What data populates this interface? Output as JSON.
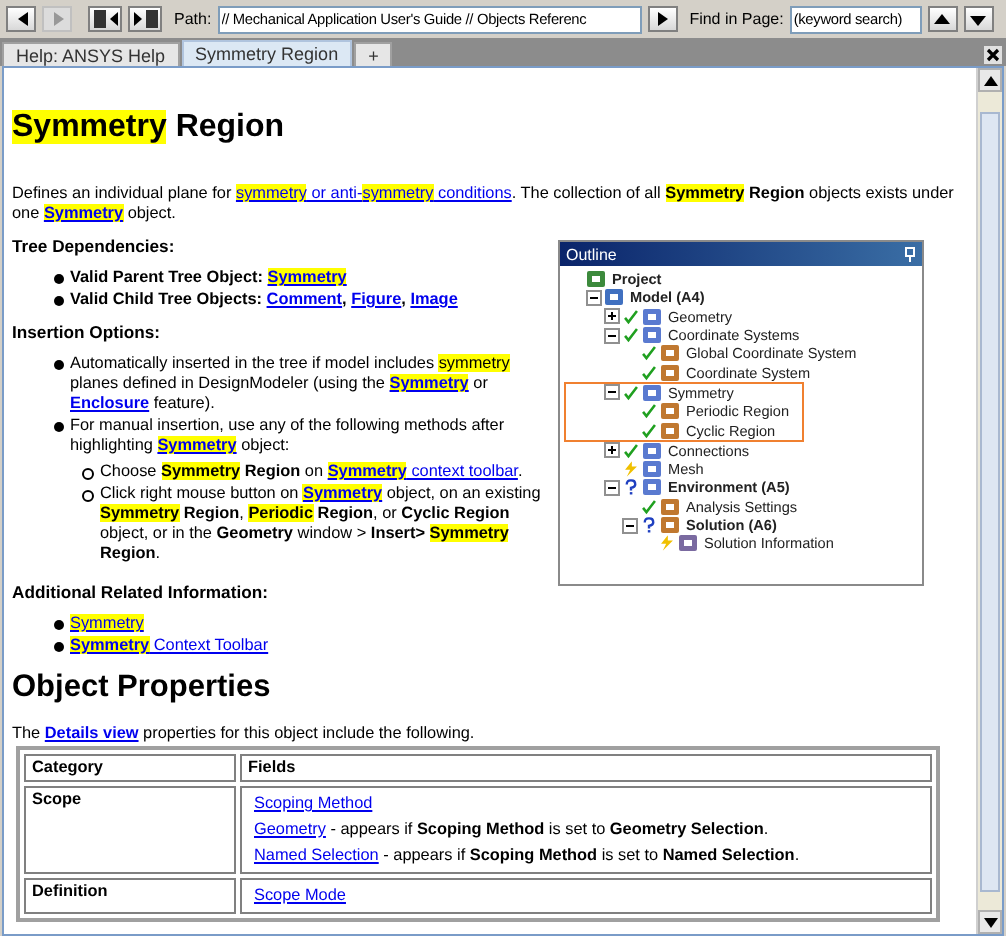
{
  "toolbar": {
    "buttons": [
      {
        "kind": "back",
        "disabled": false
      },
      {
        "kind": "forward",
        "disabled": true
      },
      {
        "kind": "previous-topic",
        "disabled": false
      },
      {
        "kind": "next-topic",
        "disabled": false
      }
    ],
    "path_label": "Path:",
    "path": "// Mechanical Application User's Guide // Objects Referenc",
    "find_label": "Find in Page:",
    "find_placeholder": "(keyword search)"
  },
  "tabs": [
    {
      "label": "Help: ANSYS Help",
      "selected": false
    },
    {
      "label": "Symmetry Region",
      "selected": true
    },
    {
      "label": "+",
      "selected": false
    }
  ],
  "doc": {
    "title": [
      {
        "text": "Symmetry",
        "kind": "highlight"
      },
      {
        "text": " Region",
        "kind": "plain"
      }
    ],
    "intro": [
      {
        "text": "Defines an individual plane for ",
        "kind": "plain"
      },
      {
        "link": [
          {
            "text": "symmetry",
            "kind": "highlight"
          },
          {
            "text": " or anti-",
            "kind": "plain"
          },
          {
            "text": "symmetry",
            "kind": "highlight"
          },
          {
            "text": " conditions",
            "kind": "plain"
          }
        ]
      },
      {
        "text": ". The collection of all ",
        "kind": "plain"
      },
      {
        "text": "Symmetry",
        "kind": "bold-highlight"
      },
      {
        "text": " Region",
        "kind": "bold"
      },
      {
        "text": " objects exists under one ",
        "kind": "plain"
      },
      {
        "link": [
          {
            "text": "Symmetry",
            "kind": "bold-highlight"
          }
        ]
      },
      {
        "text": " object.",
        "kind": "plain"
      }
    ],
    "sections": [
      {
        "heading": "Tree Dependencies:",
        "items": [
          {
            "runs": [
              {
                "text": "Valid Parent Tree Object: ",
                "kind": "bold"
              },
              {
                "link": [
                  {
                    "text": "Symmetry",
                    "kind": "bold-highlight"
                  }
                ]
              }
            ]
          },
          {
            "runs": [
              {
                "text": "Valid Child Tree Objects: ",
                "kind": "bold"
              },
              {
                "link": [
                  {
                    "text": "Comment",
                    "kind": "bold"
                  }
                ]
              },
              {
                "text": ", ",
                "kind": "bold"
              },
              {
                "link": [
                  {
                    "text": "Figure",
                    "kind": "bold"
                  }
                ]
              },
              {
                "text": ", ",
                "kind": "bold"
              },
              {
                "link": [
                  {
                    "text": "Image",
                    "kind": "bold"
                  }
                ]
              }
            ]
          }
        ]
      },
      {
        "heading": "Insertion Options:",
        "items": [
          {
            "runs": [
              {
                "text": "Automatically inserted in the tree if model includes ",
                "kind": "plain"
              },
              {
                "text": "symmetry",
                "kind": "highlight"
              },
              {
                "text": " planes defined in DesignModeler (using the ",
                "kind": "plain"
              },
              {
                "link": [
                  {
                    "text": "Symmetry",
                    "kind": "bold-highlight"
                  }
                ]
              },
              {
                "text": " or ",
                "kind": "plain"
              },
              {
                "link": [
                  {
                    "text": "Enclosure",
                    "kind": "bold"
                  }
                ]
              },
              {
                "text": " feature).",
                "kind": "plain"
              }
            ]
          },
          {
            "runs": [
              {
                "text": "For manual insertion, use any of the following methods after highlighting ",
                "kind": "plain"
              },
              {
                "link": [
                  {
                    "text": "Symmetry",
                    "kind": "bold-highlight"
                  }
                ]
              },
              {
                "text": " object:",
                "kind": "plain"
              }
            ],
            "children": [
              {
                "runs": [
                  {
                    "text": "Choose ",
                    "kind": "plain"
                  },
                  {
                    "text": "Symmetry",
                    "kind": "bold-highlight"
                  },
                  {
                    "text": " Region",
                    "kind": "bold"
                  },
                  {
                    "text": " on ",
                    "kind": "plain"
                  },
                  {
                    "link": [
                      {
                        "text": "Symmetry",
                        "kind": "bold-highlight"
                      },
                      {
                        "text": " context toolbar",
                        "kind": "plain"
                      }
                    ]
                  },
                  {
                    "text": ".",
                    "kind": "plain"
                  }
                ]
              },
              {
                "runs": [
                  {
                    "text": "Click right mouse button on ",
                    "kind": "plain"
                  },
                  {
                    "link": [
                      {
                        "text": "Symmetry",
                        "kind": "bold-highlight"
                      }
                    ]
                  },
                  {
                    "text": " object, on an existing ",
                    "kind": "plain"
                  },
                  {
                    "text": "Symmetry",
                    "kind": "bold-highlight"
                  },
                  {
                    "text": " Region",
                    "kind": "bold"
                  },
                  {
                    "text": ", ",
                    "kind": "plain"
                  },
                  {
                    "text": "Periodic",
                    "kind": "bold-highlight"
                  },
                  {
                    "text": " Region",
                    "kind": "bold"
                  },
                  {
                    "text": ", or ",
                    "kind": "plain"
                  },
                  {
                    "text": "Cyclic Region",
                    "kind": "bold"
                  },
                  {
                    "text": " object, or in the ",
                    "kind": "plain"
                  },
                  {
                    "text": "Geometry",
                    "kind": "bold"
                  },
                  {
                    "text": " window > ",
                    "kind": "plain"
                  },
                  {
                    "text": "Insert> ",
                    "kind": "bold"
                  },
                  {
                    "text": "Symmetry",
                    "kind": "bold-highlight"
                  },
                  {
                    "text": " Region",
                    "kind": "bold"
                  },
                  {
                    "text": ".",
                    "kind": "plain"
                  }
                ]
              }
            ]
          }
        ]
      },
      {
        "heading": "Additional Related Information:",
        "items": [
          {
            "runs": [
              {
                "link": [
                  {
                    "text": "Symmetry",
                    "kind": "highlight"
                  }
                ]
              }
            ]
          },
          {
            "runs": [
              {
                "link": [
                  {
                    "text": "Symmetry",
                    "kind": "bold-highlight"
                  },
                  {
                    "text": " Context Toolbar",
                    "kind": "plain"
                  }
                ]
              }
            ]
          }
        ]
      }
    ],
    "subtitle": "Object Properties",
    "table_intro": [
      {
        "text": "The ",
        "kind": "plain"
      },
      {
        "link": [
          {
            "text": "Details view",
            "kind": "bold"
          }
        ]
      },
      {
        "text": " properties for this object include the following.",
        "kind": "plain"
      }
    ],
    "table": {
      "columns": [
        "Category",
        "Fields"
      ],
      "rows": [
        {
          "category": "Scope",
          "fields": [
            [
              {
                "link": [
                  {
                    "text": "Scoping Method",
                    "kind": "plain"
                  }
                ]
              }
            ],
            [
              {
                "link": [
                  {
                    "text": "Geometry",
                    "kind": "plain"
                  }
                ]
              },
              {
                "text": " - appears if ",
                "kind": "plain"
              },
              {
                "text": "Scoping Method",
                "kind": "bold"
              },
              {
                "text": " is set to ",
                "kind": "plain"
              },
              {
                "text": "Geometry Selection",
                "kind": "bold"
              },
              {
                "text": ".",
                "kind": "plain"
              }
            ],
            [
              {
                "link": [
                  {
                    "text": "Named Selection",
                    "kind": "plain"
                  }
                ]
              },
              {
                "text": " - appears if ",
                "kind": "plain"
              },
              {
                "text": "Scoping Method",
                "kind": "bold"
              },
              {
                "text": " is set to ",
                "kind": "plain"
              },
              {
                "text": "Named Selection",
                "kind": "bold"
              },
              {
                "text": ".",
                "kind": "plain"
              }
            ]
          ]
        },
        {
          "category": "Definition",
          "fields": [
            [
              {
                "link": [
                  {
                    "text": "Scope Mode",
                    "kind": "plain"
                  }
                ]
              }
            ]
          ]
        }
      ]
    }
  },
  "outline": {
    "title": "Outline",
    "tree": [
      {
        "label": "Project",
        "bold": true,
        "highlighted": false,
        "children": [
          {
            "label": "Model (A4)",
            "bold": true,
            "highlighted": false,
            "expanded": true,
            "children": [
              {
                "label": "Geometry",
                "bold": false,
                "kind": "check",
                "highlighted": false,
                "expanded": false
              },
              {
                "label": "Coordinate Systems",
                "bold": false,
                "kind": "check",
                "highlighted": false,
                "expanded": true,
                "children": [
                  {
                    "label": "Global Coordinate System",
                    "bold": false,
                    "kind": "check",
                    "highlighted": false
                  },
                  {
                    "label": "Coordinate System",
                    "bold": false,
                    "kind": "check",
                    "highlighted": false
                  }
                ]
              },
              {
                "label": "Symmetry",
                "bold": false,
                "kind": "check",
                "highlighted": true,
                "expanded": true,
                "children": [
                  {
                    "label": "Periodic Region",
                    "bold": false,
                    "kind": "check",
                    "highlighted": false
                  },
                  {
                    "label": "Cyclic Region",
                    "bold": false,
                    "kind": "check",
                    "highlighted": false
                  }
                ]
              },
              {
                "label": "Connections",
                "bold": false,
                "kind": "check",
                "highlighted": false,
                "expanded": false
              },
              {
                "label": "Mesh",
                "bold": false,
                "kind": "lightning",
                "highlighted": false
              },
              {
                "label": "Environment (A5)",
                "bold": true,
                "kind": "question",
                "highlighted": false,
                "expanded": true,
                "children": [
                  {
                    "label": "Analysis Settings",
                    "bold": false,
                    "kind": "check",
                    "highlighted": false
                  },
                  {
                    "label": "Solution (A6)",
                    "bold": true,
                    "kind": "question",
                    "highlighted": false,
                    "expanded": true,
                    "children": [
                      {
                        "label": "Solution Information",
                        "bold": false,
                        "kind": "lightning",
                        "highlighted": false
                      }
                    ]
                  }
                ]
              }
            ]
          }
        ]
      }
    ]
  }
}
